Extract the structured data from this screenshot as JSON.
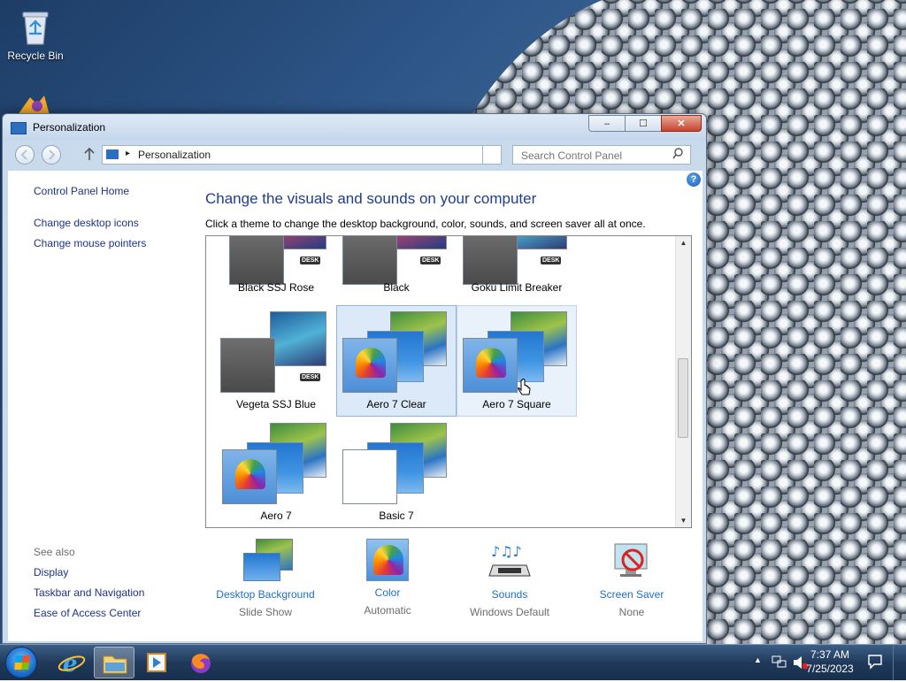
{
  "desktop": {
    "icons": [
      {
        "label": "Recycle Bin",
        "icon": "recycle-bin-icon"
      }
    ]
  },
  "window": {
    "title": "Personalization",
    "caption": {
      "minimize": "–",
      "maximize": "☐",
      "close": "✕"
    },
    "address": {
      "separator": "▸",
      "path": "Personalization"
    },
    "search": {
      "placeholder": "Search Control Panel"
    },
    "help": "?",
    "left_pane": {
      "home": "Control Panel Home",
      "links": [
        "Change desktop icons",
        "Change mouse pointers"
      ],
      "see_also_title": "See also",
      "see_also": [
        "Display",
        "Taskbar and Navigation",
        "Ease of Access Center"
      ]
    },
    "heading": "Change the visuals and sounds on your computer",
    "subtext": "Click a theme to change the desktop background, color, sounds, and screen saver all at once.",
    "themes": [
      {
        "name": "Black SSJ Rose",
        "state": "normal"
      },
      {
        "name": "Black",
        "state": "normal"
      },
      {
        "name": "Goku Limit Breaker",
        "state": "normal"
      },
      {
        "name": "Vegeta SSJ Blue",
        "state": "normal"
      },
      {
        "name": "Aero 7 Clear",
        "state": "selected"
      },
      {
        "name": "Aero 7 Square",
        "state": "hover"
      },
      {
        "name": "Aero 7",
        "state": "normal"
      },
      {
        "name": "Basic 7",
        "state": "normal"
      }
    ],
    "options": [
      {
        "label": "Desktop Background",
        "value": "Slide Show"
      },
      {
        "label": "Color",
        "value": "Automatic"
      },
      {
        "label": "Sounds",
        "value": "Windows Default"
      },
      {
        "label": "Screen Saver",
        "value": "None"
      }
    ]
  },
  "taskbar": {
    "pinned": [
      "internet-explorer-icon",
      "file-explorer-icon",
      "media-player-icon",
      "firefox-icon"
    ],
    "clock": {
      "time": "7:37 AM",
      "date": "7/25/2023"
    }
  }
}
